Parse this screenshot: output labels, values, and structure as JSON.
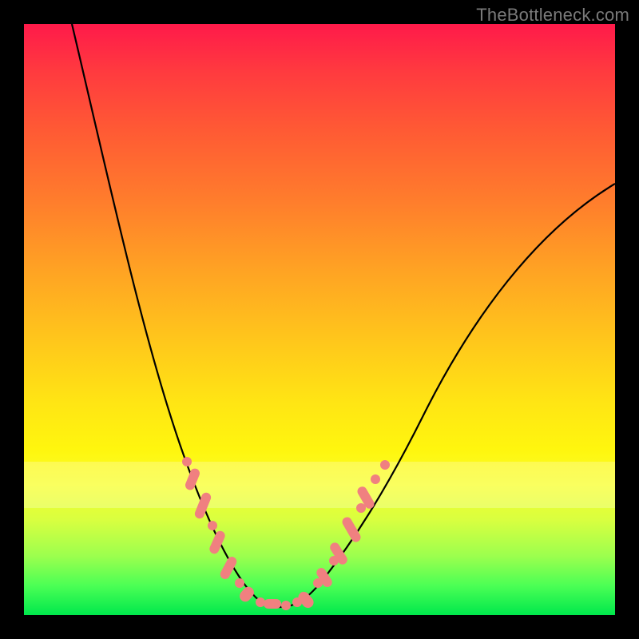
{
  "watermark": "TheBottleneck.com",
  "chart_data": {
    "type": "line",
    "title": "",
    "xlabel": "",
    "ylabel": "",
    "xlim": [
      0,
      100
    ],
    "ylim": [
      0,
      100
    ],
    "background_gradient": {
      "direction": "vertical",
      "stops": [
        {
          "pos": 0,
          "color": "#ff1a4a"
        },
        {
          "pos": 30,
          "color": "#ff7d2c"
        },
        {
          "pos": 60,
          "color": "#ffe514"
        },
        {
          "pos": 85,
          "color": "#9cff4e"
        },
        {
          "pos": 100,
          "color": "#00e84c"
        }
      ]
    },
    "series": [
      {
        "name": "bottleneck_curve",
        "color": "#000000",
        "x": [
          8,
          14,
          20,
          27,
          33,
          37,
          41,
          43,
          47,
          51,
          57,
          64,
          74,
          86,
          100
        ],
        "y": [
          100,
          74,
          46,
          27,
          18,
          10,
          5,
          2,
          2,
          6,
          14,
          24,
          38,
          56,
          73
        ]
      }
    ],
    "highlight_band": {
      "y_from": 18,
      "y_to": 26,
      "color": "rgba(255,255,255,0.25)"
    },
    "markers": {
      "color": "#f08080",
      "style": "dot-dash",
      "points": [
        {
          "x": 27,
          "y": 26
        },
        {
          "x": 29,
          "y": 22
        },
        {
          "x": 31,
          "y": 17
        },
        {
          "x": 33,
          "y": 13
        },
        {
          "x": 35,
          "y": 9
        },
        {
          "x": 37,
          "y": 6
        },
        {
          "x": 40,
          "y": 3
        },
        {
          "x": 43,
          "y": 2
        },
        {
          "x": 46,
          "y": 2
        },
        {
          "x": 49,
          "y": 4
        },
        {
          "x": 51,
          "y": 7
        },
        {
          "x": 53,
          "y": 10
        },
        {
          "x": 55,
          "y": 14
        },
        {
          "x": 57,
          "y": 18
        },
        {
          "x": 59,
          "y": 22
        },
        {
          "x": 61,
          "y": 26
        }
      ]
    }
  }
}
